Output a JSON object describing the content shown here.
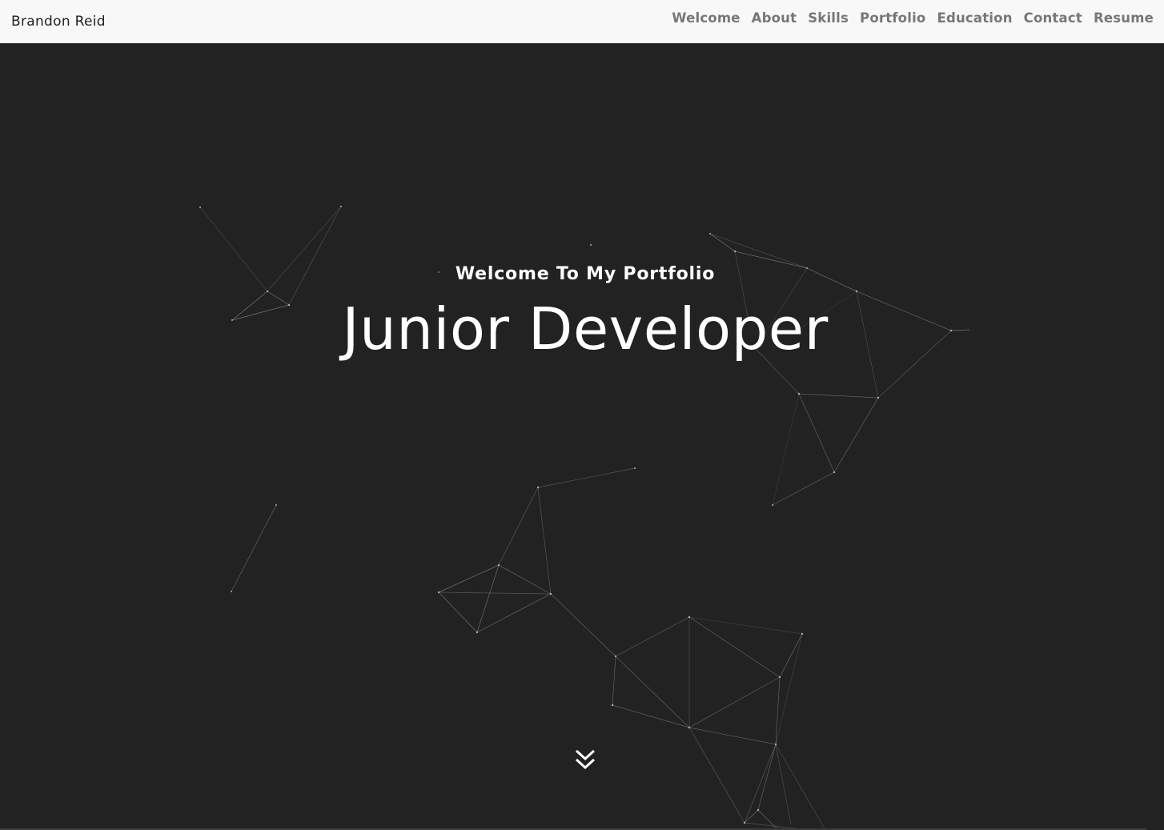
{
  "navbar": {
    "brand": "Brandon Reid",
    "links": [
      {
        "label": "Welcome"
      },
      {
        "label": "About"
      },
      {
        "label": "Skills"
      },
      {
        "label": "Portfolio"
      },
      {
        "label": "Education"
      },
      {
        "label": "Contact"
      },
      {
        "label": "Resume"
      }
    ]
  },
  "hero": {
    "intro": "Welcome To My Portfolio",
    "title": "Junior Developer",
    "scroll_icon": "chevron-double-down-icon"
  },
  "colors": {
    "navbar_bg": "#f8f8f8",
    "hero_bg": "#222222",
    "nav_text": "#777777",
    "brand_text": "#222222",
    "hero_text": "#ffffff",
    "particle_line": "#888888"
  }
}
